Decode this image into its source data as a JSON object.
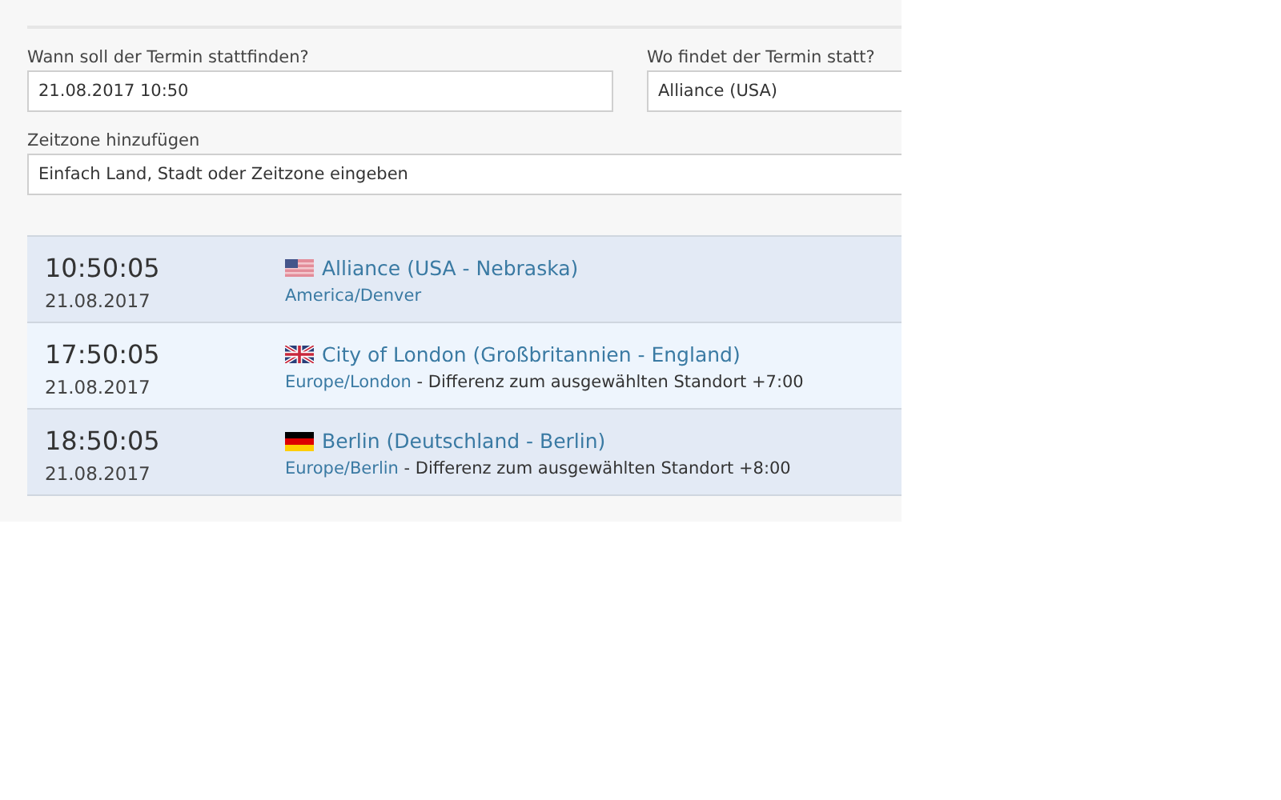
{
  "form": {
    "date_label": "Wann soll der Termin stattfinden?",
    "date_value": "21.08.2017 10:50",
    "place_label": "Wo findet der Termin statt?",
    "place_value": "Alliance (USA)",
    "timezone_label": "Zeitzone hinzufügen",
    "timezone_placeholder": "Einfach Land, Stadt oder Zeitzone eingeben"
  },
  "results": [
    {
      "time": "10:50:05",
      "date": "21.08.2017",
      "kind": "us",
      "place": "Alliance (USA - Nebraska)",
      "timezone": "America/Denver"
    },
    {
      "time": "17:50:05",
      "date": "21.08.2017",
      "kind": "gb",
      "place": "City of London (Großbritannien - England)",
      "timezone": "Europe/London",
      "difference": " - Differenz zum ausgewählten Standort +7:00"
    },
    {
      "time": "18:50:05",
      "date": "21.08.2017",
      "kind": "de",
      "place": "Berlin (Deutschland - Berlin)",
      "timezone": "Europe/Berlin",
      "difference": " - Differenz zum ausgewählten Standort +8:00"
    }
  ]
}
